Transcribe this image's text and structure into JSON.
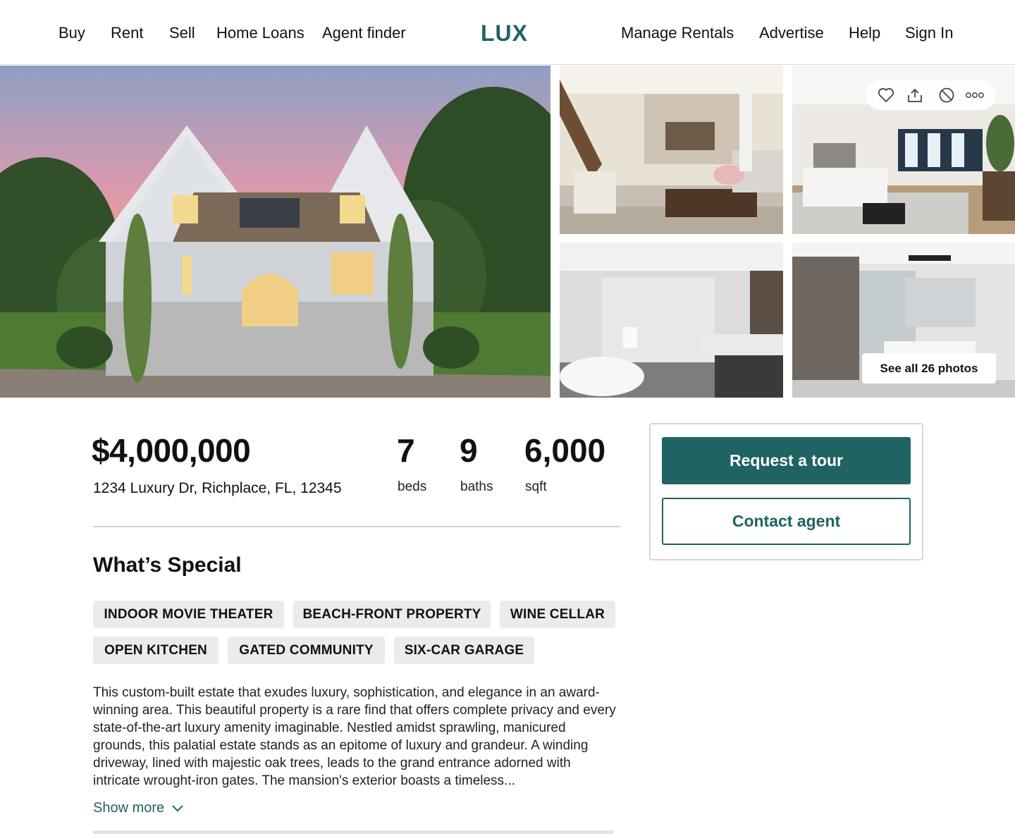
{
  "header": {
    "nav_left": [
      "Buy",
      "Rent",
      "Sell",
      "Home Loans",
      "Agent finder"
    ],
    "logo": "LUX",
    "nav_right": [
      "Manage Rentals",
      "Advertise",
      "Help",
      "Sign In"
    ]
  },
  "gallery": {
    "photos": [
      "house exterior at sunset",
      "living room and kitchen",
      "bedroom",
      "bathroom with freestanding tub",
      "bathroom with glass shower"
    ],
    "actions": [
      "heart-icon",
      "share-icon",
      "hide-icon",
      "more-icon"
    ],
    "see_all_label": "See all 26 photos"
  },
  "listing": {
    "price": "$4,000,000",
    "address": "1234 Luxury Dr, Richplace, FL, 12345",
    "beds_value": "7",
    "beds_label": "beds",
    "baths_value": "9",
    "baths_label": "baths",
    "sqft_value": "6,000",
    "sqft_label": "sqft"
  },
  "special": {
    "title": "What’s Special",
    "tags": [
      "INDOOR MOVIE THEATER",
      "BEACH-FRONT PROPERTY",
      "WINE CELLAR",
      "OPEN KITCHEN",
      "GATED COMMUNITY",
      "SIX-CAR GARAGE"
    ],
    "description": "This custom-built estate that exudes luxury, sophistication, and elegance in an award-winning area. This beautiful property is a rare find that offers complete privacy and every state-of-the-art luxury amenity imaginable. Nestled amidst sprawling, manicured grounds, this palatial estate stands as an epitome of luxury and grandeur. A winding driveway, lined with majestic oak trees, leads to the grand entrance adorned with intricate wrought-iron gates. The mansion's exterior boasts a timeless...",
    "show_more": "Show more"
  },
  "contact": {
    "request_tour": "Request a tour",
    "contact_agent": "Contact agent"
  },
  "colors": {
    "brand": "#1f6362",
    "tag_bg": "#ebebeb",
    "divider": "#cfcfcf"
  }
}
